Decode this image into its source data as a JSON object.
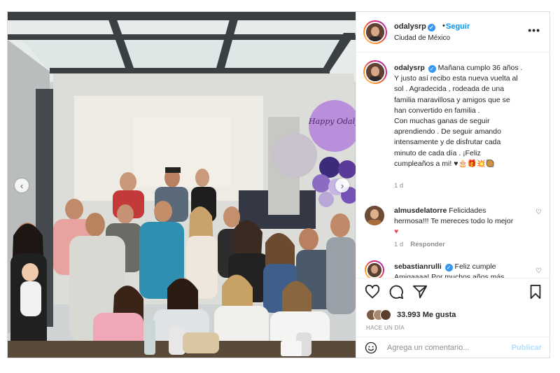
{
  "post": {
    "username": "odalysrp",
    "follow_label": "Seguir",
    "separator": "•",
    "location": "Ciudad de México",
    "more_icon": "more-options-icon",
    "verified_icon": "verified-badge-icon"
  },
  "caption": {
    "username": "odalysrp",
    "lines": [
      "Mañana cumplo 36 años .",
      "Y justo así recibo esta nueva vuelta al",
      "sol . Agradecida , rodeada de una",
      "familia maravillosa y amigos que se",
      "han convertido en familia .",
      "Con muchas ganas de seguir",
      "aprendiendo . De seguir amando",
      "intensamente y de disfrutar cada",
      "minuto de cada día . ¡Feliz",
      "cumpleaños a mi! ♥🎂🎁💥🥘"
    ],
    "time": "1 d"
  },
  "comments": [
    {
      "username": "almusdelatorre",
      "lines": [
        "Felicidades",
        "hermosa!!! Te mereces todo lo mejor",
        "♥"
      ],
      "time": "1 d",
      "reply_label": "Responder"
    },
    {
      "username": "sebastianrulli",
      "lines": [
        "Feliz cumple",
        "Amigaaaa! Por muchos años más"
      ],
      "verified": true
    }
  ],
  "actions": {
    "like_icon": "heart-icon",
    "comment_icon": "comment-icon",
    "share_icon": "share-icon",
    "save_icon": "bookmark-icon",
    "likes_text": "33.993 Me gusta",
    "time_ago": "HACE UN DÍA"
  },
  "add_comment": {
    "placeholder": "Agrega un comentario...",
    "publish_label": "Publicar",
    "emoji_icon": "emoji-icon"
  },
  "photo": {
    "balloon_text": "Happy Odalys",
    "prev_icon": "chevron-left-icon",
    "next_icon": "chevron-right-icon"
  },
  "colors": {
    "link_blue": "#0095f6",
    "publish_disabled": "#b2dffc",
    "heart_red": "#ed4956",
    "verified_blue": "#3897f0",
    "muted": "#8e8e8e"
  }
}
